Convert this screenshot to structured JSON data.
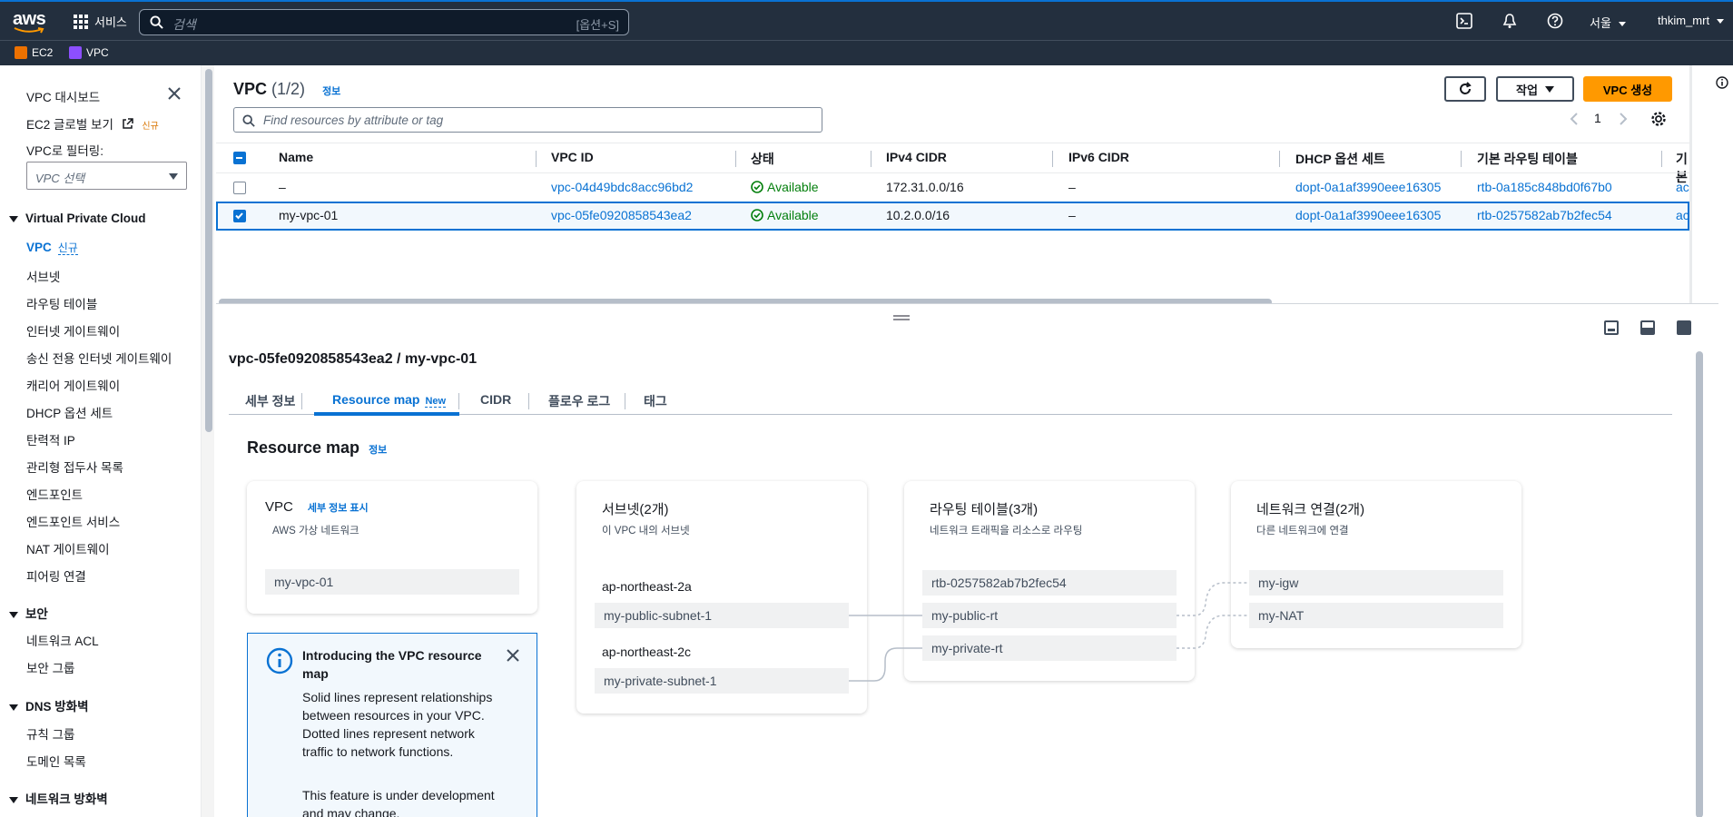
{
  "nav": {
    "logo": "aws",
    "services": "서비스",
    "search_placeholder": "검색",
    "search_shortcut": "[옵션+S]",
    "region": "서울",
    "user": "thkim_mrt",
    "icons": [
      "cloudshell-icon",
      "bell-icon",
      "help-icon"
    ]
  },
  "favorites": [
    {
      "label": "EC2",
      "color": "#ed7100"
    },
    {
      "label": "VPC",
      "color": "#8c4fff"
    }
  ],
  "sidebar": {
    "dashboard": "VPC 대시보드",
    "ec2_global": "EC2 글로벌 보기",
    "ec2_global_badge": "신규",
    "filter_label": "VPC로 필터링:",
    "filter_placeholder": "VPC 선택",
    "sections": [
      {
        "title": "Virtual Private Cloud",
        "items": [
          "VPC",
          "서브넷",
          "라우팅 테이블",
          "인터넷 게이트웨이",
          "송신 전용 인터넷 게이트웨이",
          "캐리어 게이트웨이",
          "DHCP 옵션 세트",
          "탄력적 IP",
          "관리형 접두사 목록",
          "엔드포인트",
          "엔드포인트 서비스",
          "NAT 게이트웨이",
          "피어링 연결"
        ],
        "vpc_badge": "신규"
      },
      {
        "title": "보안",
        "items": [
          "네트워크 ACL",
          "보안 그룹"
        ]
      },
      {
        "title": "DNS 방화벽",
        "items": [
          "규칙 그룹",
          "도메인 목록"
        ]
      },
      {
        "title": "네트워크 방화벽",
        "items": []
      }
    ]
  },
  "vpc_table": {
    "title": "VPC",
    "count": "(1/2)",
    "info": "정보",
    "actions_label": "작업",
    "create_label": "VPC 생성",
    "search_placeholder": "Find resources by attribute or tag",
    "page": "1",
    "columns": [
      "Name",
      "VPC ID",
      "상태",
      "IPv4 CIDR",
      "IPv6 CIDR",
      "DHCP 옵션 세트",
      "기본 라우팅 테이블",
      "기본"
    ],
    "rows": [
      {
        "name": "–",
        "vpc_id": "vpc-04d49bdc8acc96bd2",
        "status": "Available",
        "ipv4": "172.31.0.0/16",
        "ipv6": "–",
        "dhcp": "dopt-0a1af3990eee16305",
        "rtb": "rtb-0a185c848bd0f67b0",
        "more": "acl",
        "selected": false
      },
      {
        "name": "my-vpc-01",
        "vpc_id": "vpc-05fe0920858543ea2",
        "status": "Available",
        "ipv4": "10.2.0.0/16",
        "ipv6": "–",
        "dhcp": "dopt-0a1af3990eee16305",
        "rtb": "rtb-0257582ab7b2fec54",
        "more": "acl",
        "selected": true
      }
    ]
  },
  "detail": {
    "title": "vpc-05fe0920858543ea2 / my-vpc-01",
    "tabs": [
      "세부 정보",
      "Resource map",
      "CIDR",
      "플로우 로그",
      "태그"
    ],
    "new_tag": "New",
    "resource_map_title": "Resource map",
    "resource_map_info": "정보"
  },
  "resource_map": {
    "vpc": {
      "title": "VPC",
      "details_link": "세부 정보 표시",
      "subtitle": "AWS 가상 네트워크",
      "name": "my-vpc-01"
    },
    "subnets": {
      "title": "서브넷(2개)",
      "subtitle": "이 VPC 내의 서브넷",
      "groups": [
        {
          "az": "ap-northeast-2a",
          "subnet": "my-public-subnet-1"
        },
        {
          "az": "ap-northeast-2c",
          "subnet": "my-private-subnet-1"
        }
      ]
    },
    "route_tables": {
      "title": "라우팅 테이블(3개)",
      "subtitle": "네트워크 트래픽을 리소스로 라우팅",
      "items": [
        "rtb-0257582ab7b2fec54",
        "my-public-rt",
        "my-private-rt"
      ]
    },
    "network_connections": {
      "title": "네트워크 연결(2개)",
      "subtitle": "다른 네트워크에 연결",
      "items": [
        "my-igw",
        "my-NAT"
      ]
    }
  },
  "notice": {
    "title": "Introducing the VPC resource map",
    "body1": "Solid lines represent relationships between resources in your VPC. Dotted lines represent network traffic to network functions.",
    "body2": "This feature is under development and may change."
  }
}
